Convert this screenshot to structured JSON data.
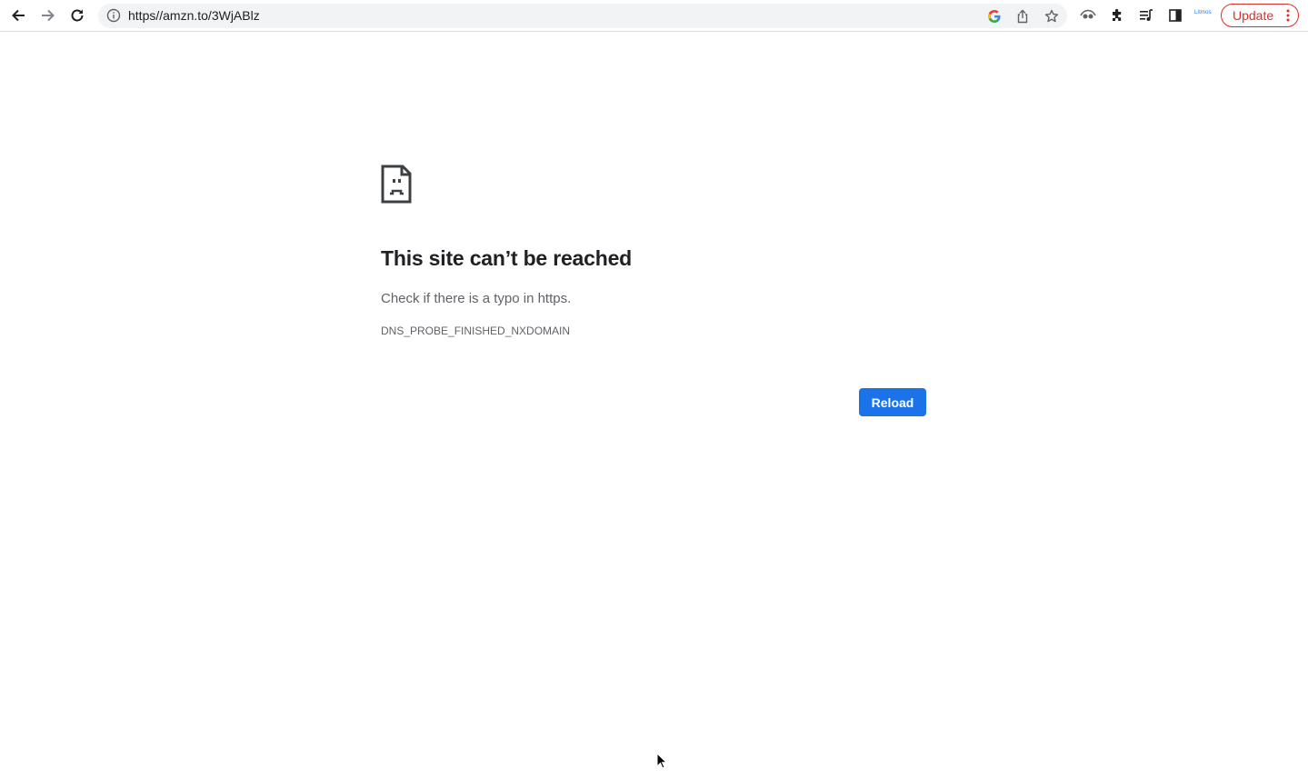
{
  "browser": {
    "url": "https//amzn.to/3WjABlz",
    "update_label": "Update",
    "extension_label": "Litmos",
    "icons": {
      "back": "back-arrow-icon",
      "forward": "forward-arrow-icon",
      "reload": "reload-icon",
      "site_info": "info-icon",
      "google": "google-icon",
      "share": "share-icon",
      "bookmark": "star-icon",
      "extension1": "extension-eye-icon",
      "extensions": "puzzle-icon",
      "media": "media-queue-icon",
      "side_panel": "side-panel-icon",
      "menu": "more-vert-icon"
    }
  },
  "error_page": {
    "title": "This site can’t be reached",
    "subtitle": "Check if there is a typo in https.",
    "error_code": "DNS_PROBE_FINISHED_NXDOMAIN",
    "reload_label": "Reload"
  },
  "colors": {
    "accent": "#1a73e8",
    "update": "#d93025",
    "omnibox_bg": "#f1f3f4"
  }
}
